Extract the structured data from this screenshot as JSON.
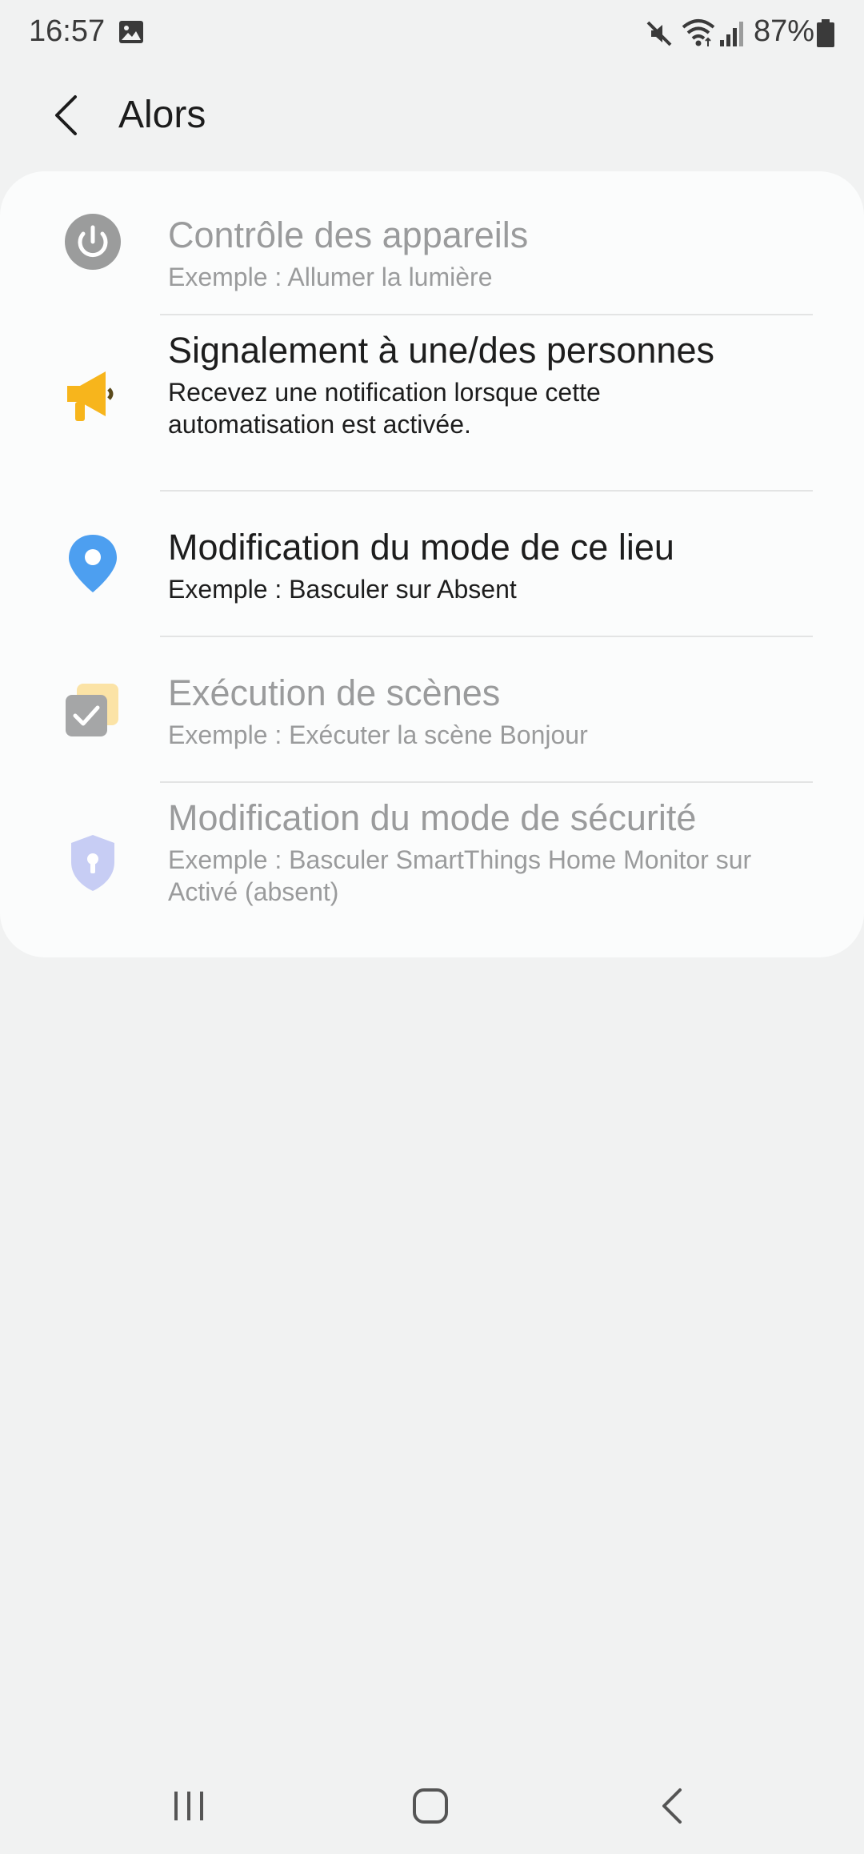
{
  "status": {
    "time": "16:57",
    "battery": "87%"
  },
  "header": {
    "title": "Alors"
  },
  "items": [
    {
      "title": "Contrôle des appareils",
      "subtitle": "Exemple : Allumer la lumière",
      "icon": "power-icon",
      "state": "disabled"
    },
    {
      "title": "Signalement à une/des personnes",
      "subtitle": "Recevez une notification lorsque cette automatisation est activée.",
      "icon": "megaphone-icon",
      "state": "enabled"
    },
    {
      "title": "Modification du mode de ce lieu",
      "subtitle": "Exemple : Basculer sur Absent",
      "icon": "location-pin-icon",
      "state": "enabled"
    },
    {
      "title": "Exécution de scènes",
      "subtitle": "Exemple : Exécuter la scène Bonjour",
      "icon": "scene-check-icon",
      "state": "disabled"
    },
    {
      "title": "Modification du mode de sécurité",
      "subtitle": "Exemple : Basculer SmartThings Home Monitor sur Activé (absent)",
      "icon": "security-shield-icon",
      "state": "disabled"
    }
  ],
  "colors": {
    "megaphone": "#f7b51c",
    "pin": "#4d9ff0",
    "power": "#9b9c9c",
    "shield": "#c7cdf4",
    "scene_back": "#fbe3a6",
    "scene_front": "#a5a6a7"
  }
}
